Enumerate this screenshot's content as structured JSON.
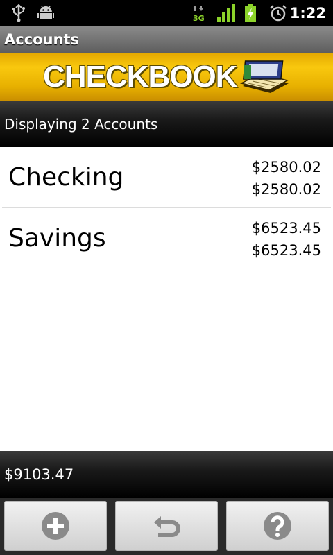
{
  "status_bar": {
    "time": "1:22",
    "network_label": "3G",
    "icons": [
      "usb-icon",
      "android-debug-icon",
      "3g-data-icon",
      "signal-icon",
      "battery-charging-icon",
      "alarm-icon"
    ]
  },
  "app": {
    "title": "Accounts",
    "banner_text": "CHECKBOOK",
    "accent_color": "#f4c20d"
  },
  "header": {
    "text": "Displaying 2 Accounts"
  },
  "accounts": [
    {
      "name": "Checking",
      "balance": "$2580.02",
      "cleared_balance": "$2580.02"
    },
    {
      "name": "Savings",
      "balance": "$6523.45",
      "cleared_balance": "$6523.45"
    }
  ],
  "footer": {
    "total": "$9103.47"
  },
  "buttons": [
    {
      "icon": "add-icon"
    },
    {
      "icon": "back-icon"
    },
    {
      "icon": "help-icon"
    }
  ]
}
